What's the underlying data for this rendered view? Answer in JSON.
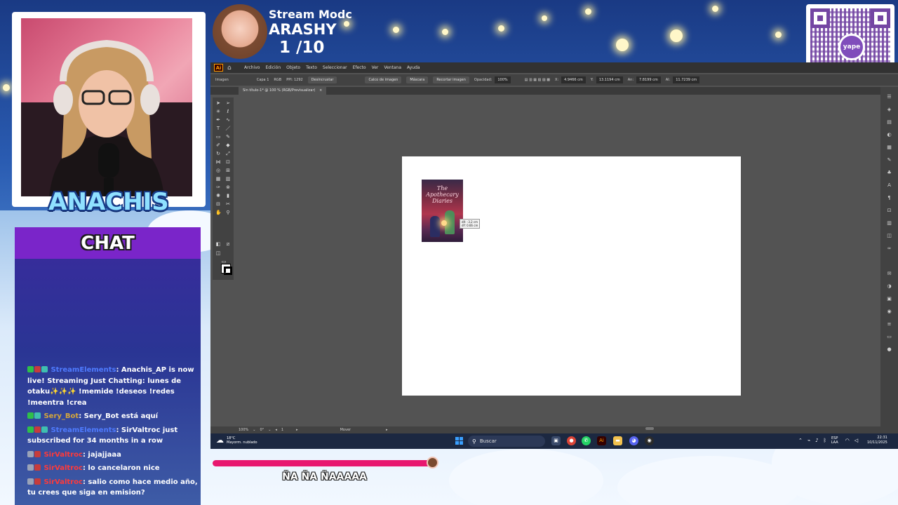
{
  "overlay": {
    "streamer_name": "ANACHIS",
    "stream_mode_label": "Stream Modc",
    "stream_mode_user": "ARASHY",
    "stream_mode_count": "1 /10",
    "qr_brand": "yape"
  },
  "chat": {
    "title": "CHAT",
    "messages": [
      {
        "user": "StreamElements",
        "user_color": "#4f7bff",
        "text": ": Anachis_AP is now live! Streaming Just Chatting: lunes de otaku✨✨✨ !memide !deseos !redes !meentra !crea"
      },
      {
        "user": "Sery_Bot",
        "user_color": "#d5a63a",
        "text": ": Sery_Bot está aquí"
      },
      {
        "user": "StreamElements",
        "user_color": "#4f7bff",
        "text": ": SirValtroc just subscribed for 34 months in a row"
      },
      {
        "user": "SirValtroc",
        "user_color": "#ff3a3a",
        "text": ": jajajjaaa"
      },
      {
        "user": "SirValtroc",
        "user_color": "#ff3a3a",
        "text": ": lo cancelaron nice"
      },
      {
        "user": "SirValtroc",
        "user_color": "#ff3a3a",
        "text": ": salio como hace medio año, tu crees que siga en emision?"
      }
    ]
  },
  "illustrator": {
    "menu": [
      "Archivo",
      "Edición",
      "Objeto",
      "Texto",
      "Seleccionar",
      "Efecto",
      "Ver",
      "Ventana",
      "Ayuda"
    ],
    "control_bar": {
      "object_type": "Imagen",
      "layer_info": "Capa 1",
      "color_mode": "RGB",
      "ppi": "PPI: 1292",
      "unembed_button": "Desincrustar",
      "trace_button": "Calco de imagen",
      "mask_button": "Máscara",
      "crop_button": "Recortar imagen",
      "opacity_label": "Opacidad:",
      "opacity_value": "100%",
      "x_label": "X:",
      "x_value": "4.9466 cm",
      "y_label": "Y:",
      "y_value": "13.1194 cm",
      "w_label": "An:",
      "w_value": "7.8199 cm",
      "h_label": "Al:",
      "h_value": "11.7239 cm"
    },
    "doc_tab": "Sin título-1* @ 100 % (RGB/Previsualizar)",
    "book_title": "The Apothecary Diaries",
    "drag_tooltip_dx": "dX: -3.2 cm",
    "drag_tooltip_dy": "dY: 0.66 cm",
    "status_zoom": "100%",
    "status_artboard": "1",
    "status_tool": "Mover"
  },
  "taskbar": {
    "weather_temp": "18°C",
    "weather_desc": "Mayorm. nublado",
    "search_placeholder": "Buscar",
    "lang_top": "ESP",
    "lang_bottom": "LAA",
    "time": "22:31",
    "date": "10/11/2025"
  },
  "goal_bar": {
    "label": "ÑA ÑA ÑAAAAA",
    "progress": 0.98
  }
}
